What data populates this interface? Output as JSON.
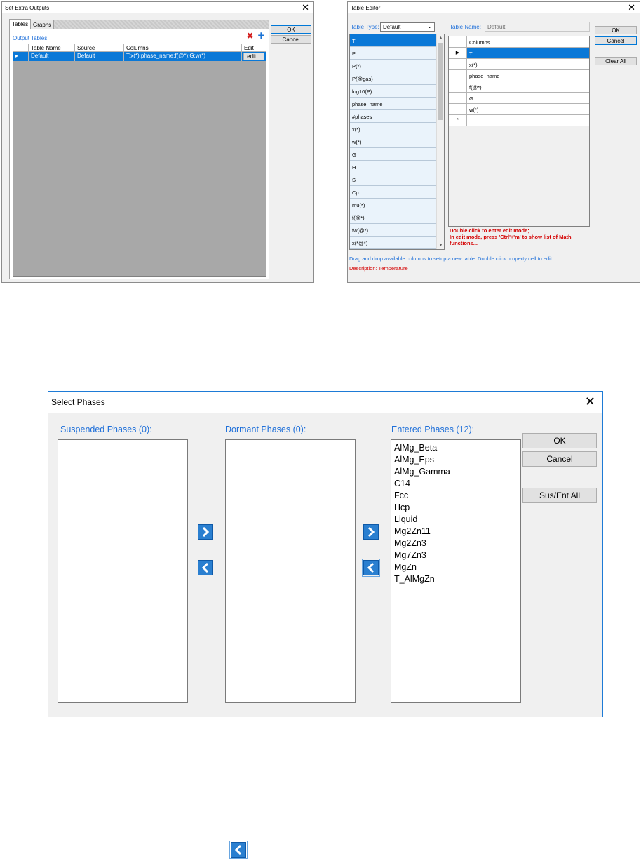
{
  "extra_outputs": {
    "title": "Set Extra Outputs",
    "tabs": [
      "Tables",
      "Graphs"
    ],
    "output_tables_label": "Output Tables:",
    "columns": [
      "Table Name",
      "Source",
      "Columns",
      "Edit"
    ],
    "rows": [
      {
        "name": "Default",
        "source": "Default",
        "columns": "T;x(*);phase_name;f(@*);G;w(*)",
        "edit": "edit..."
      }
    ],
    "ok": "OK",
    "cancel": "Cancel"
  },
  "table_editor": {
    "title": "Table Editor",
    "table_type_label": "Table Type:",
    "table_type_value": "Default",
    "table_name_label": "Table Name:",
    "table_name_value": "Default",
    "available_columns": [
      "T",
      "P",
      "P(*)",
      "P(@gas)",
      "log10(P)",
      "phase_name",
      "#phases",
      "x(*)",
      "w(*)",
      "G",
      "H",
      "S",
      "Cp",
      "mu(*)",
      "f(@*)",
      "fw(@*)",
      "x(*@*)"
    ],
    "selected_available": "T",
    "columns_header": "Columns",
    "columns": [
      "T",
      "x(*)",
      "phase_name",
      "f(@*)",
      "G",
      "w(*)"
    ],
    "new_row_marker": "*",
    "current_row_marker": "▶",
    "note_red_1": "Double click to enter edit mode;",
    "note_red_2": "In edit mode, press 'Ctrl'+'m' to show list of Math functions...",
    "help_text": "Drag and drop available columns to setup a new table. Double click property cell to edit.",
    "description": "Description: Temperature",
    "ok": "OK",
    "cancel": "Cancel",
    "clear_all": "Clear All"
  },
  "select_phases": {
    "title": "Select Phases",
    "suspended_label": "Suspended Phases (0):",
    "dormant_label": "Dormant Phases (0):",
    "entered_label": "Entered Phases (12):",
    "suspended": [],
    "dormant": [],
    "entered": [
      "AlMg_Beta",
      "AlMg_Eps",
      "AlMg_Gamma",
      "C14",
      "Fcc",
      "Hcp",
      "Liquid",
      "Mg2Zn11",
      "Mg2Zn3",
      "Mg7Zn3",
      "MgZn",
      "T_AlMgZn"
    ],
    "ok": "OK",
    "cancel": "Cancel",
    "sus_ent_all": "Sus/Ent All"
  },
  "colors": {
    "accent_blue": "#1e6fd9",
    "selection": "#0a78d7",
    "note_red": "#d40000"
  }
}
